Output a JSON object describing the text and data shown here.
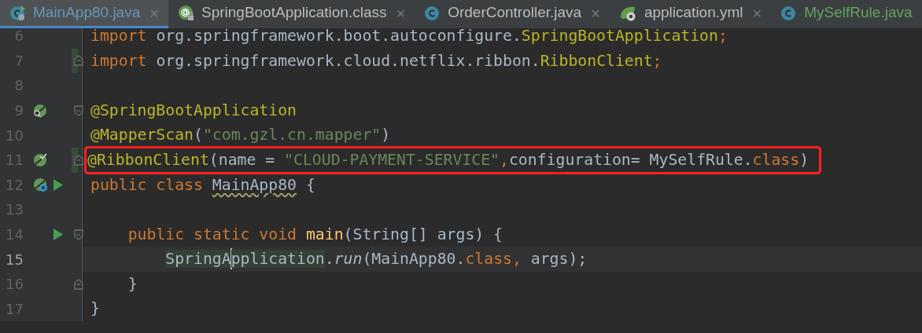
{
  "tabs": [
    {
      "label": "MainApp80.java",
      "kind": "runnable-class",
      "color": "#6897bb",
      "selected": true,
      "closable": true
    },
    {
      "label": "SpringBootApplication.class",
      "kind": "locked-annotation",
      "color": "#bbbbbb",
      "selected": false,
      "closable": true
    },
    {
      "label": "OrderController.java",
      "kind": "class",
      "color": "#bbbbbb",
      "selected": false,
      "closable": true
    },
    {
      "label": "application.yml",
      "kind": "config",
      "color": "#bbbbbb",
      "selected": false,
      "closable": true
    },
    {
      "label": "MySelfRule.java",
      "kind": "class",
      "color": "#62a35c",
      "selected": false,
      "closable": false
    }
  ],
  "close_glyph": "×",
  "lines": [
    {
      "number": "6",
      "tokens": [
        {
          "kind": "keyword",
          "text": "import "
        },
        {
          "kind": "plain",
          "text": "org.springframework.boot.autoconfigure."
        },
        {
          "kind": "annotation",
          "text": "SpringBootApplication"
        },
        {
          "kind": "keyword",
          "text": ";"
        }
      ]
    },
    {
      "number": "7",
      "fold_end": true,
      "changed": true,
      "tokens": [
        {
          "kind": "keyword",
          "text": "import "
        },
        {
          "kind": "plain",
          "text": "org.springframework.cloud.netflix.ribbon."
        },
        {
          "kind": "annotation",
          "text": "RibbonClient"
        },
        {
          "kind": "keyword",
          "text": ";"
        }
      ]
    },
    {
      "number": "8"
    },
    {
      "number": "9",
      "fold_start": true,
      "gutter": {
        "kind": "bean-search"
      },
      "tokens": [
        {
          "kind": "annotation",
          "text": "@SpringBootApplication"
        }
      ]
    },
    {
      "number": "10",
      "tokens": [
        {
          "kind": "annotation",
          "text": "@MapperScan"
        },
        {
          "kind": "plain",
          "text": "("
        },
        {
          "kind": "string",
          "text": "\"com.gzl.cn.mapper\""
        },
        {
          "kind": "plain",
          "text": ")"
        }
      ]
    },
    {
      "number": "11",
      "fold_end": true,
      "changed": true,
      "boxed": true,
      "gutter": {
        "kind": "bean-check"
      },
      "tokens": [
        {
          "kind": "annotation",
          "text": "@RibbonClient"
        },
        {
          "kind": "plain",
          "text": "(name = "
        },
        {
          "kind": "string",
          "text": "\"CLOUD-PAYMENT-SERVICE\""
        },
        {
          "kind": "keyword",
          "text": ","
        },
        {
          "kind": "plain",
          "text": "configuration= MySelfRule."
        },
        {
          "kind": "keyword",
          "text": "class"
        },
        {
          "kind": "plain",
          "text": ")"
        }
      ]
    },
    {
      "number": "12",
      "gutter": {
        "kind": "bean-run"
      },
      "run": true,
      "tokens": [
        {
          "kind": "keyword",
          "text": "public class "
        },
        {
          "kind": "typo",
          "text": "MainApp80"
        },
        {
          "kind": "plain",
          "text": " {"
        }
      ]
    },
    {
      "number": "13"
    },
    {
      "number": "14",
      "fold_start": true,
      "run": true,
      "tokens": [
        {
          "kind": "keyword",
          "text": "    public static void "
        },
        {
          "kind": "method",
          "text": "main"
        },
        {
          "kind": "plain",
          "text": "(String[] args) {"
        }
      ]
    },
    {
      "number": "15",
      "current": true,
      "tokens": [
        {
          "kind": "usage",
          "text": "        SpringA",
          "caret_after": true
        },
        {
          "kind": "usage",
          "text": "pplication"
        },
        {
          "kind": "plain",
          "text": "."
        },
        {
          "kind": "static-call",
          "text": "run"
        },
        {
          "kind": "plain",
          "text": "(MainApp80."
        },
        {
          "kind": "keyword",
          "text": "class, "
        },
        {
          "kind": "plain",
          "text": "args);"
        }
      ]
    },
    {
      "number": "16",
      "fold_end": true,
      "tokens": [
        {
          "kind": "plain",
          "text": "    }"
        }
      ]
    },
    {
      "number": "17",
      "tokens": [
        {
          "kind": "plain",
          "text": "}"
        }
      ]
    }
  ]
}
